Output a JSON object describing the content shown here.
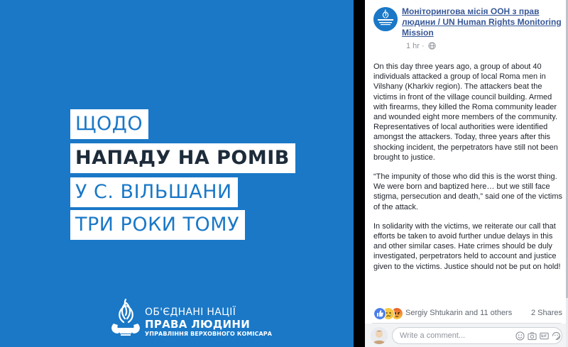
{
  "image": {
    "headline": [
      "ЩОДО",
      "НАПАДУ НА РОМІВ",
      "У С. ВІЛЬШАНИ",
      "ТРИ РОКИ ТОМУ"
    ],
    "org": {
      "line1": "ОБ'ЄДНАНІ НАЦІЇ",
      "line2": "ПРАВА ЛЮДИНИ",
      "line3": "УПРАВЛІННЯ ВЕРХОВНОГО КОМІСАРА"
    },
    "bg_color": "#1a78c7"
  },
  "post": {
    "page_name": "Моніторингова місія ООН з прав людини / UN Human Rights Monitoring Mission",
    "time": "1 hr",
    "paragraphs": [
      "On this day three years ago, a group of about 40 individuals attacked a group of local Roma men in Vilshany (Kharkiv region). The attackers beat the victims in front of the village council building. Armed with firearms, they killed the Roma community leader and wounded eight more members of the community. Representatives of local authorities were identified amongst the attackers. Today, three years after this shocking incident, the perpetrators have still not been brought to justice.",
      "“The impunity of those who did this is the worst thing. We were born and baptized here… but we still face stigma, persecution and death,” said one of the victims of the attack.",
      "In solidarity with the victims, we reiterate our call that efforts be taken to avoid further undue delays in this and other similar cases. Hate crimes should be duly investigated, perpetrators held to account and justice given to the victims. Justice should not be put on hold!"
    ],
    "reactions": {
      "icons": [
        "like-icon",
        "sad-icon",
        "angry-icon"
      ],
      "names": "Sergiy Shtukarin and 11 others",
      "shares": "2 Shares"
    },
    "comment": {
      "placeholder": "Write a comment...",
      "icons": [
        "emoji-icon",
        "camera-icon",
        "gif-icon",
        "sticker-icon"
      ]
    }
  }
}
